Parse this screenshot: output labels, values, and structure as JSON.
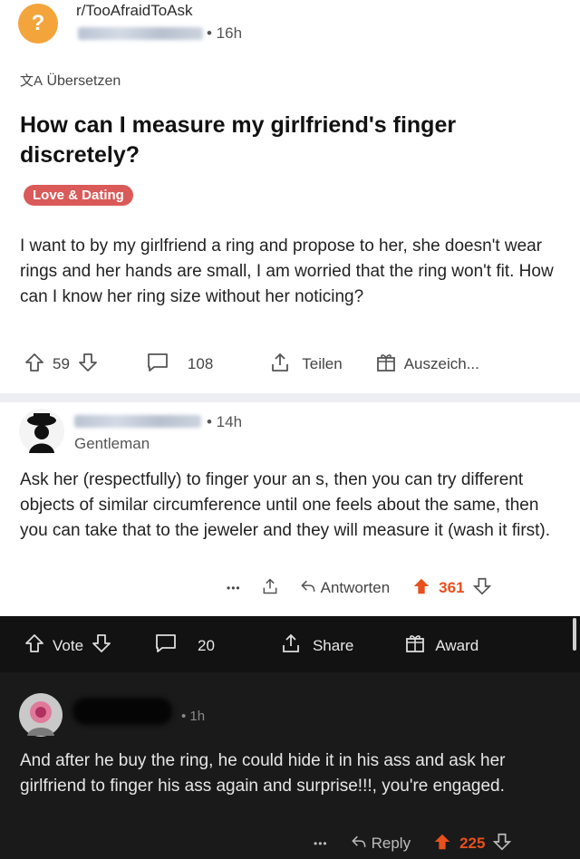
{
  "post": {
    "subreddit": "r/TooAfraidToAsk",
    "time": "• 16h",
    "translate_label": "Übersetzen",
    "title": "How can I measure my girlfriend's finger discretely?",
    "flair": "Love & Dating",
    "body": "I want to by my girlfriend a ring and propose to her, she doesn't wear rings and her hands are small, I am worried that the ring won't fit. How can I know her ring size without her noticing?",
    "actions": {
      "votes": "59",
      "comments": "108",
      "share": "Teilen",
      "award": "Auszeich..."
    }
  },
  "comment1": {
    "time": "• 14h",
    "user_flair": "Gentleman",
    "text": "Ask her (respectfully) to finger your an  s, then you can try different objects of similar circumference until one feels about the same, then you can take that to the jeweler and they will measure it (wash it first).",
    "more": "•••",
    "reply": "Antworten",
    "votes": "361"
  },
  "dark_bar": {
    "vote": "Vote",
    "comments": "20",
    "share": "Share",
    "award": "Award"
  },
  "comment2": {
    "time": "• 1h",
    "text": "And after he buy the ring, he could hide it in his ass and ask her girlfriend to finger his ass again and surprise!!!, you're engaged.",
    "more": "•••",
    "reply": "Reply",
    "votes": "225"
  },
  "colors": {
    "upvote_active": "#e8501c",
    "flair_bg": "#d95a59",
    "dark_bg": "#121212"
  }
}
